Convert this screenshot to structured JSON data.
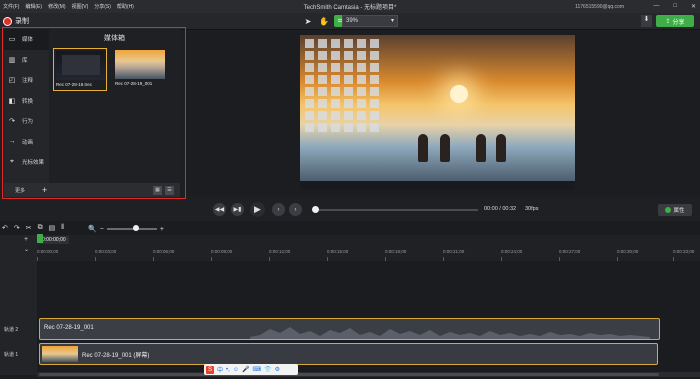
{
  "window": {
    "title": "TechSmith Camtasia - 无标题项目*",
    "account": "1176515590@qq.com",
    "menu": [
      "文件(F)",
      "编辑(E)",
      "修改(M)",
      "视图(V)",
      "分享(S)",
      "帮助(H)"
    ],
    "controls": [
      "—",
      "□",
      "✕"
    ]
  },
  "toolbar": {
    "record_label": "录制",
    "zoom_value": "39%",
    "share_label": "分享",
    "accent_color": "#3fae49"
  },
  "sidebar": {
    "items": [
      {
        "label": "媒体",
        "icon": "film-icon"
      },
      {
        "label": "库",
        "icon": "library-icon"
      },
      {
        "label": "注释",
        "icon": "annotation-icon"
      },
      {
        "label": "转换",
        "icon": "transition-icon"
      },
      {
        "label": "行为",
        "icon": "behavior-icon"
      },
      {
        "label": "动画",
        "icon": "animation-icon"
      },
      {
        "label": "光标效果",
        "icon": "cursor-effect-icon"
      }
    ],
    "more_label": "更多"
  },
  "media_bin": {
    "title": "媒体箱",
    "items": [
      {
        "name": "Rec 07-28-19.trec"
      },
      {
        "name": "Rec 07-28-19_001"
      }
    ]
  },
  "transport": {
    "time": "00:00 / 00:32",
    "fps": "30fps",
    "properties_label": "属性"
  },
  "timeline": {
    "playhead_time": "0:00:00;00",
    "ticks": [
      "0:00:00;00",
      "0:00:03;00",
      "0:00:06;00",
      "0:00:09;00",
      "0:00:12;00",
      "0:00:15;00",
      "0:00:18;00",
      "0:00:21;00",
      "0:00:24;00",
      "0:00:27;00",
      "0:00:30;00",
      "0:00:33;00"
    ],
    "tracks": [
      {
        "label": "轨道 2",
        "clip": "Rec 07-28-19_001"
      },
      {
        "label": "轨道 1",
        "clip": "Rec 07-28-19_001 (屏幕)"
      }
    ]
  },
  "ime_bar": {
    "logo": "S",
    "mode": "中"
  }
}
